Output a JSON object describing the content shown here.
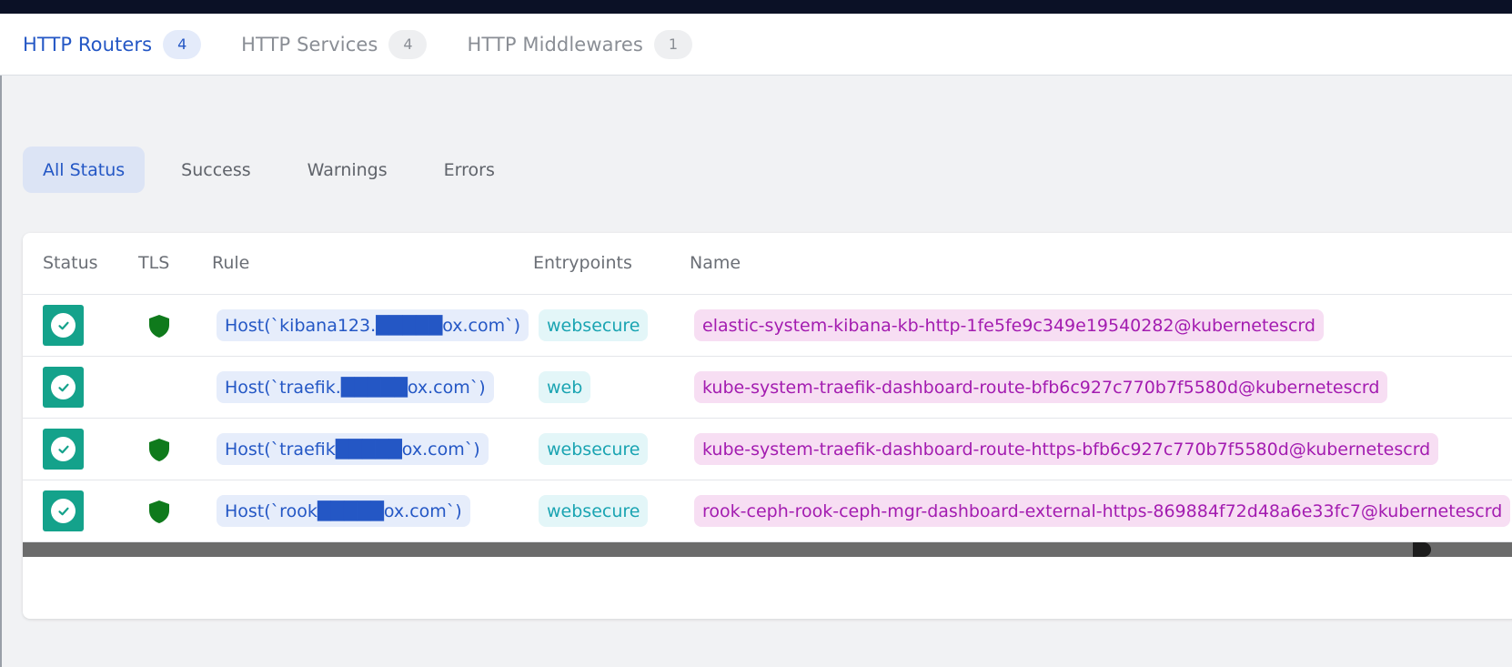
{
  "tabs": [
    {
      "label": "HTTP Routers",
      "count": "4"
    },
    {
      "label": "HTTP Services",
      "count": "4"
    },
    {
      "label": "HTTP Middlewares",
      "count": "1"
    }
  ],
  "filters": [
    {
      "label": "All Status"
    },
    {
      "label": "Success"
    },
    {
      "label": "Warnings"
    },
    {
      "label": "Errors"
    }
  ],
  "table": {
    "headers": {
      "status": "Status",
      "tls": "TLS",
      "rule": "Rule",
      "entrypoints": "Entrypoints",
      "name": "Name"
    },
    "rows": [
      {
        "rule": "Host(`kibana123.█████ox.com`)",
        "entrypoint": "websecure",
        "name": "elastic-system-kibana-kb-http-1fe5fe9c349e19540282@kubernetescrd",
        "tls": true
      },
      {
        "rule": "Host(`traefik.█████ox.com`)",
        "entrypoint": "web",
        "name": "kube-system-traefik-dashboard-route-bfb6c927c770b7f5580d@kubernetescrd",
        "tls": false
      },
      {
        "rule": "Host(`traefik█████ox.com`)",
        "entrypoint": "websecure",
        "name": "kube-system-traefik-dashboard-route-https-bfb6c927c770b7f5580d@kubernetescrd",
        "tls": true
      },
      {
        "rule": "Host(`rook█████ox.com`)",
        "entrypoint": "websecure",
        "name": "rook-ceph-rook-ceph-mgr-dashboard-external-https-869884f72d48a6e33fc7@kubernetescrd",
        "tls": true
      }
    ]
  },
  "icons": {
    "status": "check-circle-icon",
    "tls": "shield-icon"
  },
  "colors": {
    "accent": "#2457c5",
    "success": "#14a28b",
    "tls_shield": "#0f7a1c",
    "topbar": "#0b1126"
  }
}
